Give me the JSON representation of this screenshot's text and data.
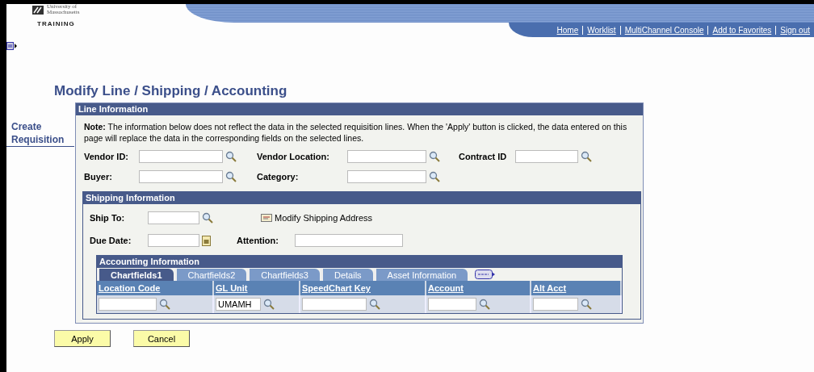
{
  "header": {
    "logo_line1": "University of",
    "logo_line2": "Massachusetts",
    "logo_subtitle": "TRAINING"
  },
  "nav_links": [
    "Home",
    "Worklist",
    "MultiChannel Console",
    "Add to Favorites",
    "Sign out"
  ],
  "sidebar_link": "Create Requisition",
  "page_title": "Modify Line / Shipping / Accounting",
  "line_information": {
    "title": "Line Information",
    "note": "**Note:** The information below does not reflect the data in the selected requisition lines. When the 'Apply' button is clicked, the data entered on this page will replace the data in the corresponding fields on the selected lines.",
    "rows": [
      [
        {
          "label": "Vendor ID:",
          "kind": "lookup"
        },
        {
          "label": "Vendor Location:",
          "kind": "lookup"
        },
        {
          "label": "Contract ID",
          "kind": "lookup"
        }
      ],
      [
        {
          "label": "Buyer:",
          "kind": "lookup"
        },
        {
          "label": "Category:",
          "kind": "lookup"
        }
      ]
    ]
  },
  "shipping_information": {
    "title": "Shipping Information",
    "ship_to": {
      "label": "Ship To:",
      "kind": "lookup"
    },
    "modify_address_link": "Modify Shipping Address",
    "due_date": {
      "label": "Due Date:",
      "kind": "calendar"
    },
    "attention": {
      "label": "Attention:"
    }
  },
  "accounting_information": {
    "title": "Accounting Information",
    "tabs": [
      {
        "label": "Chartfields1",
        "selected": true
      },
      {
        "label": "Chartfields2",
        "selected": false
      },
      {
        "label": "Chartfields3",
        "selected": false
      },
      {
        "label": "Details",
        "selected": false
      },
      {
        "label": "Asset Information",
        "selected": false
      }
    ],
    "columns": [
      "Location Code",
      "GL Unit",
      "SpeedChart Key",
      "Account",
      "Alt Acct"
    ],
    "row": [
      {
        "kind": "lookup"
      },
      {
        "kind": "lookup",
        "value": "UMAMH"
      },
      {
        "kind": "lookup"
      },
      {
        "kind": "lookup"
      },
      {
        "kind": "lookup"
      }
    ]
  },
  "buttons": [
    "Apply",
    "Cancel"
  ]
}
